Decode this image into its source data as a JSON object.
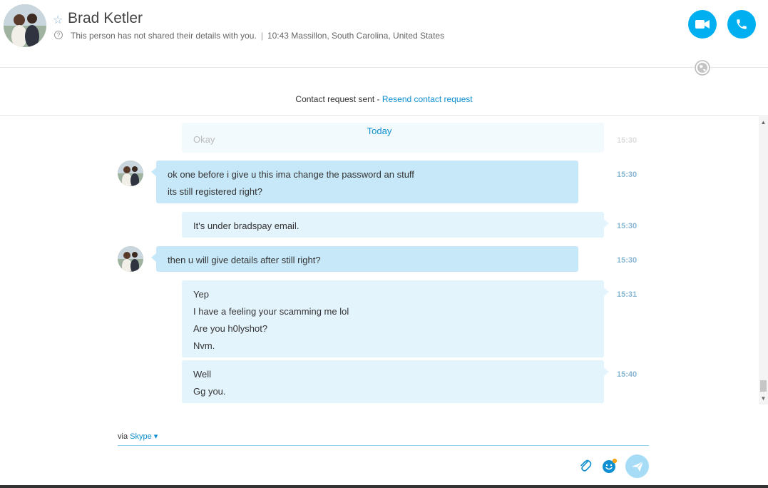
{
  "contact": {
    "name": "Brad Ketler",
    "details_note": "This person has not shared their details with you.",
    "local_time_location": "10:43 Massillon, South Carolina, United States"
  },
  "notice": {
    "text": "Contact request sent - ",
    "link": "Resend contact request"
  },
  "chat": {
    "date_divider": "Today",
    "ghost_message": "Okay",
    "ghost_time": "15:30",
    "messages": [
      {
        "direction": "in",
        "lines": [
          "ok one before i give u this ima change the password an stuff",
          "its still registered right?"
        ],
        "time": "15:30"
      },
      {
        "direction": "out",
        "lines": [
          "It's under bradspay email."
        ],
        "time": "15:30"
      },
      {
        "direction": "in",
        "lines": [
          "then u will give details after still right?"
        ],
        "time": "15:30"
      },
      {
        "direction": "out",
        "lines": [
          "Yep",
          "I have a feeling your scamming me lol",
          "Are you h0lyshot?",
          "Nvm."
        ],
        "time": "15:31"
      },
      {
        "direction": "out",
        "lines": [
          "Well",
          "Gg you."
        ],
        "time": "15:40"
      }
    ]
  },
  "composer": {
    "via_label": "via",
    "via_service": "Skype"
  },
  "icons": {
    "video": "video-camera-icon",
    "call": "phone-icon",
    "globe": "globe-icon",
    "attach": "paperclip-icon",
    "emoji": "emoticon-icon",
    "send": "send-icon"
  },
  "colors": {
    "accent": "#00aff0",
    "incoming_bubble": "#c7e8f9",
    "outgoing_bubble": "#e4f4fd",
    "link": "#0f8fcf"
  }
}
